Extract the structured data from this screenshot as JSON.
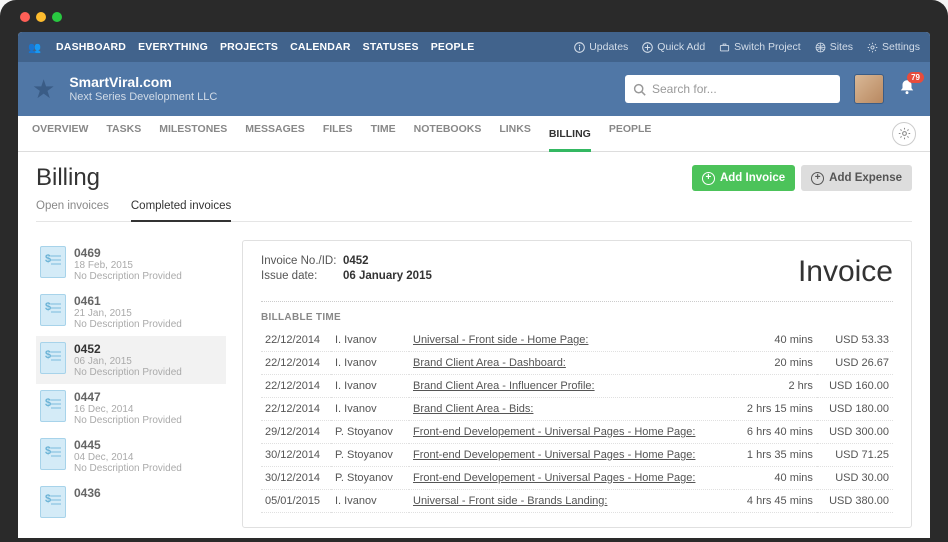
{
  "topnav": [
    "DASHBOARD",
    "EVERYTHING",
    "PROJECTS",
    "CALENDAR",
    "STATUSES",
    "PEOPLE"
  ],
  "topright": {
    "updates": "Updates",
    "quickadd": "Quick Add",
    "switch": "Switch Project",
    "sites": "Sites",
    "settings": "Settings"
  },
  "brand": {
    "title": "SmartViral.com",
    "subtitle": "Next Series Development LLC"
  },
  "search": {
    "placeholder": "Search for..."
  },
  "notifications": {
    "count": "79"
  },
  "subnav": [
    "OVERVIEW",
    "TASKS",
    "MILESTONES",
    "MESSAGES",
    "FILES",
    "TIME",
    "NOTEBOOKS",
    "LINKS",
    "BILLING",
    "PEOPLE"
  ],
  "subnav_active": "BILLING",
  "page_title": "Billing",
  "buttons": {
    "add_invoice": "Add Invoice",
    "add_expense": "Add Expense"
  },
  "inv_tabs": {
    "open": "Open invoices",
    "completed": "Completed invoices"
  },
  "invoices": [
    {
      "num": "0469",
      "date": "18 Feb, 2015",
      "desc": "No Description Provided"
    },
    {
      "num": "0461",
      "date": "21 Jan, 2015",
      "desc": "No Description Provided"
    },
    {
      "num": "0452",
      "date": "06 Jan, 2015",
      "desc": "No Description Provided"
    },
    {
      "num": "0447",
      "date": "16 Dec, 2014",
      "desc": "No Description Provided"
    },
    {
      "num": "0445",
      "date": "04 Dec, 2014",
      "desc": "No Description Provided"
    },
    {
      "num": "0436",
      "date": "",
      "desc": ""
    }
  ],
  "detail": {
    "labels": {
      "no": "Invoice No./ID:",
      "issue": "Issue date:",
      "big": "Invoice",
      "section": "BILLABLE TIME"
    },
    "no": "0452",
    "issue": "06 January 2015",
    "rows": [
      {
        "d": "22/12/2014",
        "p": "I. Ivanov",
        "t": "Universal - Front side - Home Page:",
        "dur": "40 mins",
        "amt": "USD 53.33"
      },
      {
        "d": "22/12/2014",
        "p": "I. Ivanov",
        "t": "Brand Client Area - Dashboard:",
        "dur": "20 mins",
        "amt": "USD 26.67"
      },
      {
        "d": "22/12/2014",
        "p": "I. Ivanov",
        "t": "Brand Client Area - Influencer Profile:",
        "dur": "2 hrs",
        "amt": "USD 160.00"
      },
      {
        "d": "22/12/2014",
        "p": "I. Ivanov",
        "t": "Brand Client Area - Bids:",
        "dur": "2 hrs 15 mins",
        "amt": "USD 180.00"
      },
      {
        "d": "29/12/2014",
        "p": "P. Stoyanov",
        "t": "Front-end Developement - Universal Pages - Home Page:",
        "dur": "6 hrs 40 mins",
        "amt": "USD 300.00"
      },
      {
        "d": "30/12/2014",
        "p": "P. Stoyanov",
        "t": "Front-end Developement - Universal Pages - Home Page:",
        "dur": "1 hrs 35 mins",
        "amt": "USD 71.25"
      },
      {
        "d": "30/12/2014",
        "p": "P. Stoyanov",
        "t": "Front-end Developement - Universal Pages - Home Page:",
        "dur": "40 mins",
        "amt": "USD 30.00"
      },
      {
        "d": "05/01/2015",
        "p": "I. Ivanov",
        "t": "Universal - Front side - Brands Landing:",
        "dur": "4 hrs 45 mins",
        "amt": "USD 380.00"
      }
    ]
  }
}
